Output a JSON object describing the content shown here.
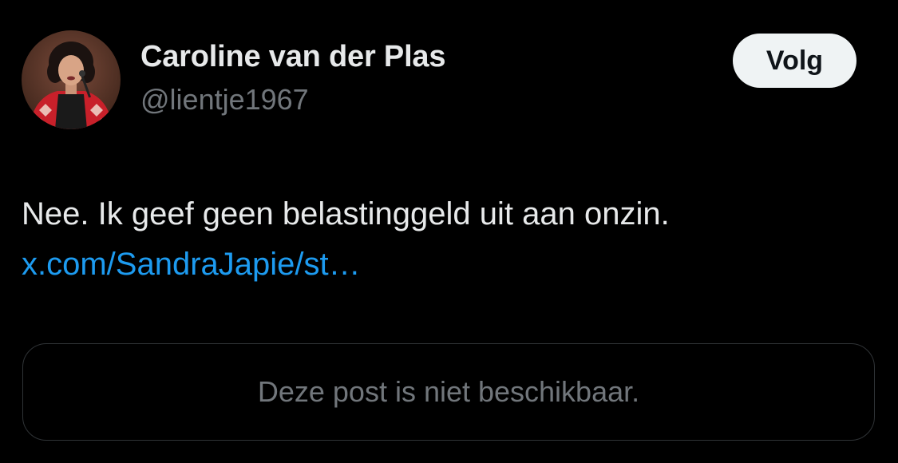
{
  "author": {
    "display_name": "Caroline van der Plas",
    "handle": "@lientje1967",
    "avatar_icon": "profile-photo"
  },
  "follow_button": {
    "label": "Volg"
  },
  "post": {
    "text": "Nee. Ik geef geen belastinggeld uit aan onzin.",
    "link": "x.com/SandraJapie/st…"
  },
  "quoted_post": {
    "unavailable_message": "Deze post is niet beschikbaar."
  },
  "colors": {
    "background": "#000000",
    "primary_text": "#e7e9ea",
    "secondary_text": "#71767b",
    "link": "#1d9bf0",
    "follow_button_bg": "#eff3f4",
    "border": "#2f3336"
  }
}
